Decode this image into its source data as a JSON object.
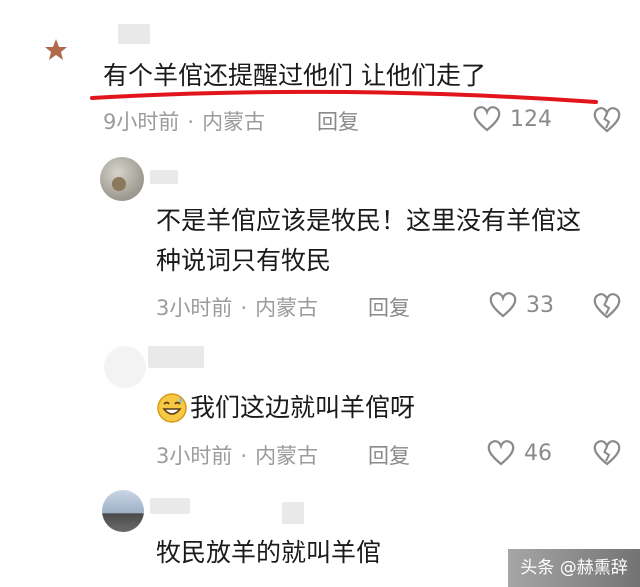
{
  "comments": [
    {
      "text": "有个羊倌还提醒过他们 让他们走了",
      "time": "9小时前",
      "location": "内蒙古",
      "reply_label": "回复",
      "likes": "124",
      "avatar_icon": "star-avatar-icon"
    },
    {
      "text_line1": "不是羊倌应该是牧民！这里没有羊倌这",
      "text_line2": "种说词只有牧民",
      "time": "3小时前",
      "location": "内蒙古",
      "reply_label": "回复",
      "likes": "33"
    },
    {
      "text": "我们这边就叫羊倌呀",
      "emoji_icon": "laugh-sweat-emoji-icon",
      "time": "3小时前",
      "location": "内蒙古",
      "reply_label": "回复",
      "likes": "46"
    },
    {
      "text": "牧民放羊的就叫羊倌"
    }
  ],
  "watermark": "头条 @赫熏辞",
  "colors": {
    "underline": "#e2141c",
    "meta_text": "#9b9b9b",
    "icon_gray": "#8a8a8a"
  },
  "icons": [
    "heart-outline-icon",
    "broken-heart-icon"
  ]
}
